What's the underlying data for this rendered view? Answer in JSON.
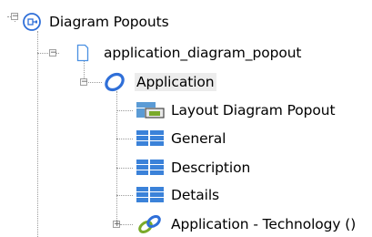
{
  "tree": {
    "root": {
      "label": "Diagram Popouts",
      "icon": "diagram-popout-icon",
      "expander": "−"
    },
    "file": {
      "label": "application_diagram_popout",
      "icon": "document-icon",
      "expander": "−"
    },
    "element": {
      "label": "Application",
      "icon": "application-ring-icon",
      "expander": "−",
      "selected": true
    },
    "children": [
      {
        "label": "Layout Diagram Popout",
        "icon": "layout-diagram-icon"
      },
      {
        "label": "General",
        "icon": "grid-table-icon"
      },
      {
        "label": "Description",
        "icon": "grid-table-icon"
      },
      {
        "label": "Details",
        "icon": "grid-table-icon"
      },
      {
        "label": "Application - Technology ()",
        "icon": "relationship-link-icon",
        "expander": "+"
      }
    ]
  },
  "colors": {
    "accent_blue": "#2f6fd8",
    "tree_line": "#9a9a9a",
    "selected_bg": "#ececec",
    "link_green": "#7aaa2a"
  }
}
